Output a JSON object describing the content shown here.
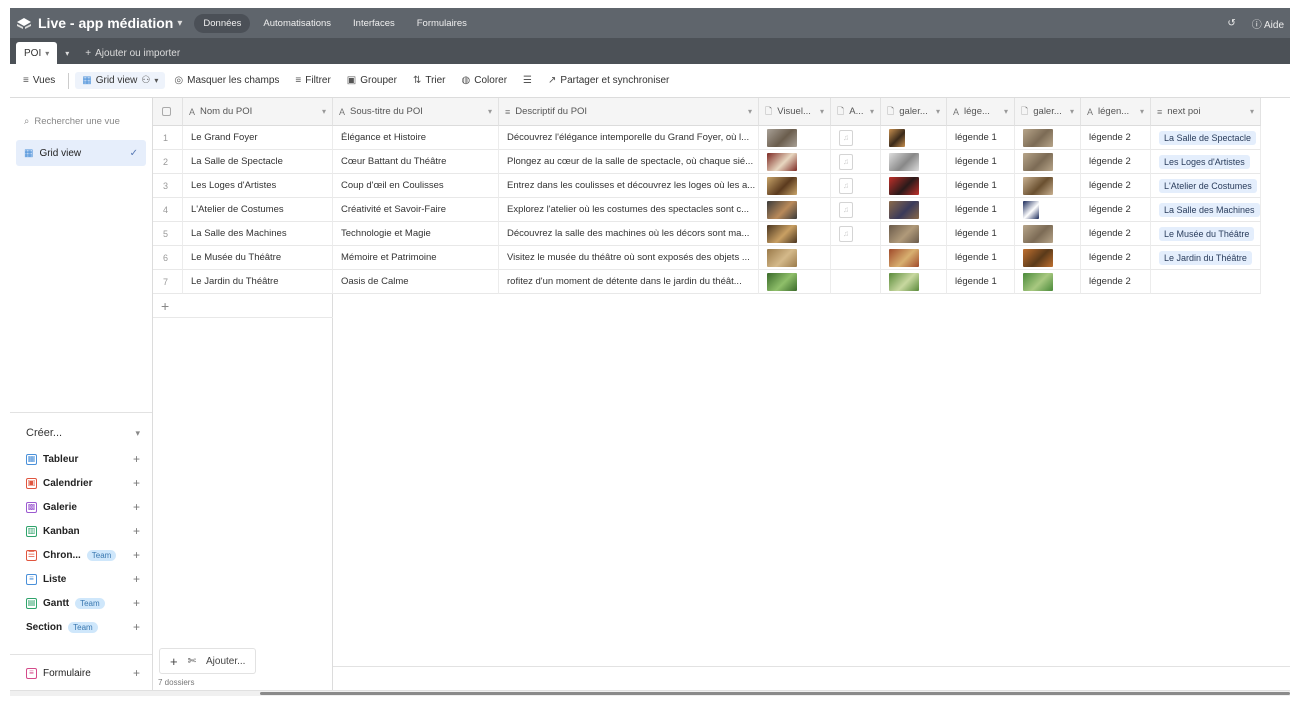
{
  "app": {
    "title": "Live - app médiation",
    "nav": [
      "Données",
      "Automatisations",
      "Interfaces",
      "Formulaires"
    ],
    "help": "Aide"
  },
  "tabs": {
    "active": "POI",
    "add": "Ajouter ou importer"
  },
  "toolbar": {
    "views": "Vues",
    "grid_view": "Grid view",
    "hide_fields": "Masquer les champs",
    "filter": "Filtrer",
    "group": "Grouper",
    "sort": "Trier",
    "color": "Colorer",
    "share": "Partager et synchroniser"
  },
  "sidebar": {
    "search_placeholder": "Rechercher une vue",
    "grid_view": "Grid view",
    "create_label": "Créer...",
    "create_items": [
      {
        "label": "Tableur",
        "team": false,
        "color": "#4a90d9",
        "icon": "grid-icon"
      },
      {
        "label": "Calendrier",
        "team": false,
        "color": "#e0553e",
        "icon": "calendar-icon"
      },
      {
        "label": "Galerie",
        "team": false,
        "color": "#9b59d0",
        "icon": "gallery-icon"
      },
      {
        "label": "Kanban",
        "team": false,
        "color": "#2fa36b",
        "icon": "kanban-icon"
      },
      {
        "label": "Chron...",
        "team": true,
        "color": "#e0553e",
        "icon": "timeline-icon"
      },
      {
        "label": "Liste",
        "team": false,
        "color": "#4a90d9",
        "icon": "list-icon"
      },
      {
        "label": "Gantt",
        "team": true,
        "color": "#2fa36b",
        "icon": "gantt-icon"
      }
    ],
    "section_label": "Section",
    "team_badge": "Team",
    "form_label": "Formulaire"
  },
  "grid": {
    "columns": [
      {
        "label": "Nom du POI",
        "icon": "A"
      },
      {
        "label": "Sous-titre du POI",
        "icon": "A"
      },
      {
        "label": "Descriptif du POI",
        "icon": "≡"
      },
      {
        "label": "Visuel...",
        "icon": "🗋"
      },
      {
        "label": "A...",
        "icon": "🗋"
      },
      {
        "label": "galer...",
        "icon": "🗋"
      },
      {
        "label": "lége...",
        "icon": "A"
      },
      {
        "label": "galer...",
        "icon": "🗋"
      },
      {
        "label": "légen...",
        "icon": "A"
      },
      {
        "label": "next poi",
        "icon": "≡"
      }
    ],
    "rows": [
      {
        "num": "1",
        "name": "Le Grand Foyer",
        "subtitle": "Élégance et Histoire",
        "desc": "Découvrez l'élégance intemporelle du Grand Foyer, où l...",
        "legend1": "légende 1",
        "legend2": "légende 2",
        "next": "La Salle de Spectacle",
        "audio": true
      },
      {
        "num": "2",
        "name": "La Salle de Spectacle",
        "subtitle": "Cœur Battant du Théâtre",
        "desc": "Plongez au cœur de la salle de spectacle, où chaque sié...",
        "legend1": "légende 1",
        "legend2": "légende 2",
        "next": "Les Loges d'Artistes",
        "audio": true
      },
      {
        "num": "3",
        "name": "Les Loges d'Artistes",
        "subtitle": "Coup d'œil en Coulisses",
        "desc": "Entrez dans les coulisses et découvrez les loges où les a...",
        "legend1": "légende 1",
        "legend2": "légende 2",
        "next": "L'Atelier de Costumes",
        "audio": true
      },
      {
        "num": "4",
        "name": "L'Atelier de Costumes",
        "subtitle": "Créativité et Savoir-Faire",
        "desc": "Explorez l'atelier où les costumes des spectacles sont c...",
        "legend1": "légende 1",
        "legend2": "légende 2",
        "next": "La Salle des Machines",
        "audio": true
      },
      {
        "num": "5",
        "name": "La Salle des Machines",
        "subtitle": "Technologie et Magie",
        "desc": "Découvrez la salle des machines où les décors sont ma...",
        "legend1": "légende 1",
        "legend2": "légende 2",
        "next": "Le Musée du Théâtre",
        "audio": true
      },
      {
        "num": "6",
        "name": "Le Musée du Théâtre",
        "subtitle": "Mémoire et Patrimoine",
        "desc": "Visitez le musée du théâtre où sont exposés des objets ...",
        "legend1": "légende 1",
        "legend2": "légende 2",
        "next": "Le Jardin du Théâtre",
        "audio": false
      },
      {
        "num": "7",
        "name": "Le Jardin du Théâtre",
        "subtitle": "Oasis de Calme",
        "desc": "rofitez d'un moment de détente dans le jardin du théât...",
        "legend1": "légende 1",
        "legend2": "légende 2",
        "next": "",
        "audio": false
      }
    ],
    "add_label": "Ajouter...",
    "record_count": "7 dossiers"
  }
}
